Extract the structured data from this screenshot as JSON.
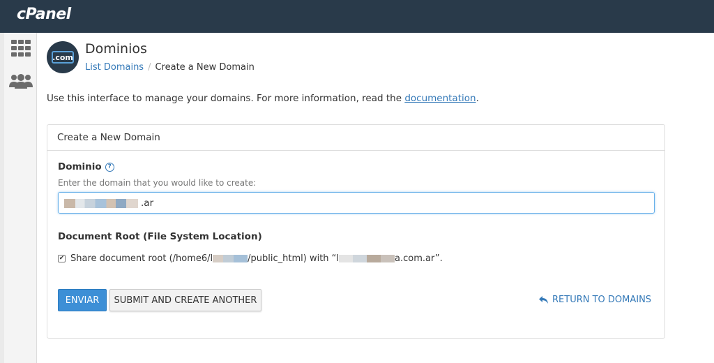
{
  "header": {
    "brand": "cPanel"
  },
  "sidebar": {
    "icons": [
      "grid-icon",
      "users-icon"
    ]
  },
  "page": {
    "logo_text": ".com",
    "title": "Dominios",
    "breadcrumb": {
      "parent": "List Domains",
      "separator": "/",
      "current": "Create a New Domain"
    },
    "intro_prefix": "Use this interface to manage your domains. For more information, read the ",
    "intro_link": "documentation",
    "intro_suffix": "."
  },
  "panel": {
    "title": "Create a New Domain",
    "domain_label": "Dominio",
    "help_icon": "?",
    "domain_hint": "Enter the domain that you would like to create:",
    "domain_value_visible": ".ar",
    "docroot_label": "Document Root (File System Location)",
    "share_prefix": "Share document root (/home6/l",
    "share_middle": " /public_html) with “l",
    "share_suffix": "a.com.ar”.",
    "share_checked": true,
    "submit_label": "ENVIAR",
    "submit_another_label": "SUBMIT AND CREATE ANOTHER",
    "return_label": "RETURN TO DOMAINS"
  },
  "colors": {
    "topbar": "#293a4a",
    "primary": "#3d8fd6",
    "link": "#3479b8"
  }
}
